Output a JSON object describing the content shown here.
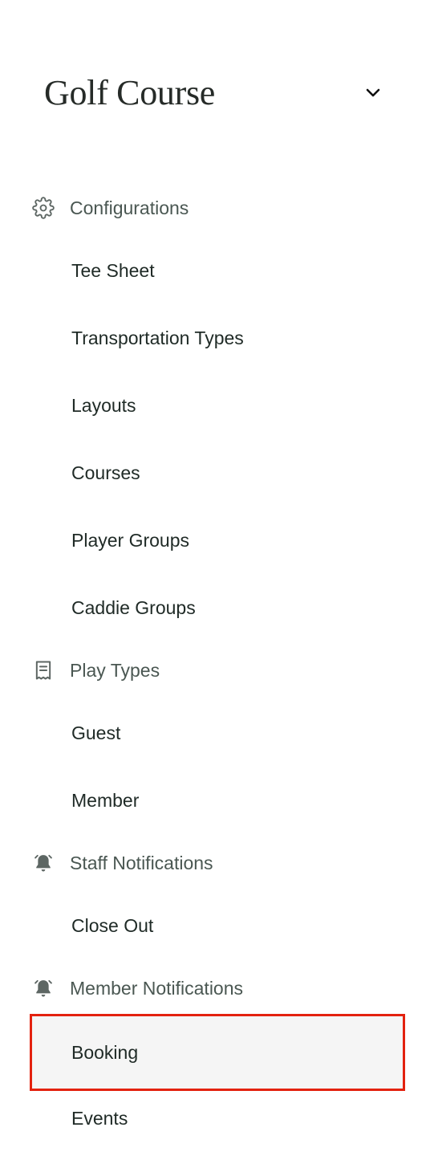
{
  "header": {
    "title": "Golf Course",
    "dropdown_icon": "chevron-down-icon"
  },
  "sections": [
    {
      "label": "Configurations",
      "icon": "gear-icon",
      "items": [
        "Tee Sheet",
        "Transportation Types",
        "Layouts",
        "Courses",
        "Player Groups",
        "Caddie Groups"
      ]
    },
    {
      "label": "Play Types",
      "icon": "receipt-icon",
      "items": [
        "Guest",
        "Member"
      ]
    },
    {
      "label": "Staff Notifications",
      "icon": "bell-icon",
      "items": [
        "Close Out"
      ]
    },
    {
      "label": "Member Notifications",
      "icon": "bell-icon",
      "items": [
        "Booking",
        "Events"
      ]
    }
  ],
  "selected_item": "Booking",
  "colors": {
    "selected_border": "#e3220f",
    "selected_background": "#f5f5f5",
    "section_text": "#4a5752",
    "item_text": "#1f2a26"
  }
}
